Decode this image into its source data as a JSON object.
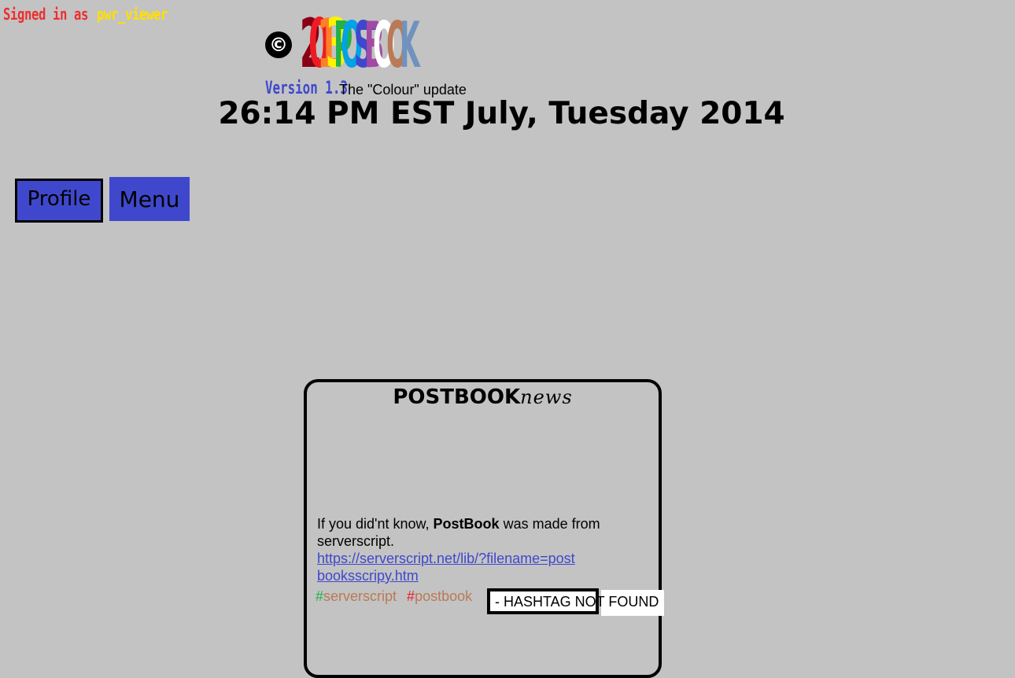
{
  "header": {
    "signed_in_label": "Signed in as",
    "username": "pwr_viewer",
    "copyright_symbol": "©",
    "logo_year_digits": [
      "2",
      "0",
      "1",
      "3"
    ],
    "logo_word_letters": [
      "P",
      "O",
      "S",
      "T",
      "B",
      "O",
      "O",
      "K"
    ],
    "version": "Version 1.3",
    "update_name": "The \"Colour\" update",
    "clock": "26:14 PM EST July, Tuesday 2014"
  },
  "colors": {
    "background": "#c3c3c3",
    "accent_blue": "#3f48cc",
    "signed_in_red": "#ed2f2f",
    "username_yellow": "#ffe000",
    "logo_year": [
      "#880015",
      "#ed1c24",
      "#ff7f27",
      "#fff200"
    ],
    "logo_word": [
      "#22b14c",
      "#00a2e8",
      "#3f48cc",
      "#3f48cc",
      "#a349a4",
      "#ffffff",
      "#b97a57",
      "#7092be"
    ]
  },
  "nav": {
    "profile_label": "Profile",
    "menu_label": "Menu"
  },
  "news": {
    "title": "POSTBOOK",
    "title_suffix": "news",
    "text_before": "If you did'nt know,",
    "brand": "PostBook",
    "text_after": "was made from serverscript.",
    "link_text": "https://serverscript.net/lib/?filename=postbooksscripy.htm",
    "tags": [
      {
        "hash": "#",
        "name": "serverscript"
      },
      {
        "hash": "#",
        "name": "postbook"
      }
    ],
    "hashtag_status": "- HASHTAG NOT FOUND"
  }
}
